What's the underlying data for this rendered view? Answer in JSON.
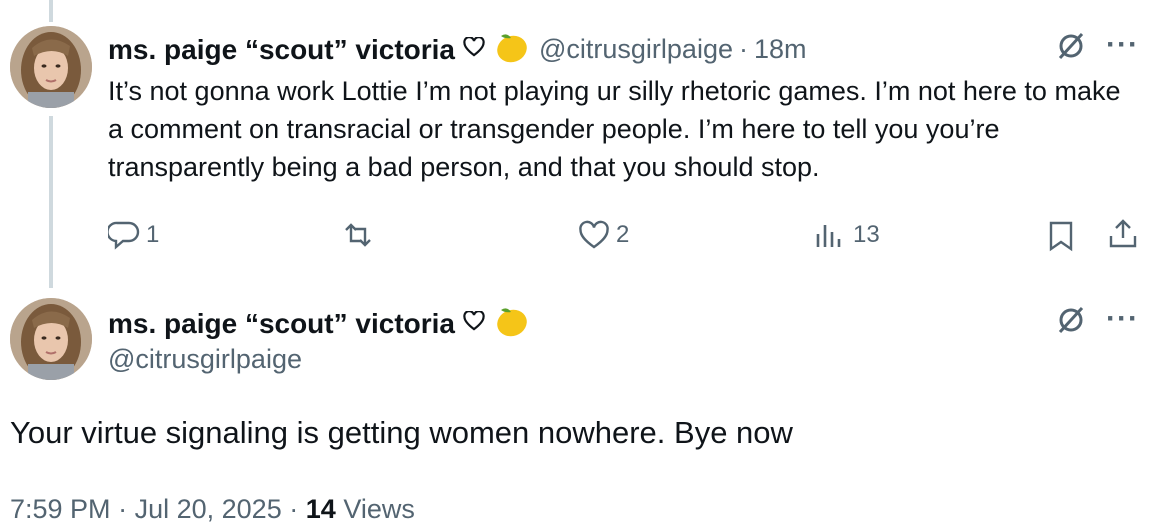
{
  "reply_tweet": {
    "author_name": "ms. paige “scout” victoria",
    "handle": "@citrusgirlpaige",
    "separator": "·",
    "time_ago": "18m",
    "text": "It’s not gonna work Lottie I’m not playing ur silly rhetoric games. I’m not here to make a comment on transracial or transgender people. I’m here to tell you you’re transparently being a bad person, and that you should stop.",
    "replies": "1",
    "likes": "2",
    "views": "13"
  },
  "main_tweet": {
    "author_name": "ms. paige “scout” victoria",
    "handle": "@citrusgirlpaige",
    "text": "Your virtue signaling is getting women nowhere. Bye now",
    "time": "7:59 PM",
    "date": "Jul 20, 2025",
    "separator": "·",
    "views_count": "14",
    "views_label": "Views"
  },
  "more_label": "···",
  "icons": [
    "heart-outline-icon",
    "lemon-emoji-icon",
    "grok-icon",
    "more-icon",
    "reply-icon",
    "retweet-icon",
    "like-icon",
    "views-icon",
    "bookmark-icon",
    "share-icon"
  ],
  "colors": {
    "text": "#0f1419",
    "secondary": "#536471",
    "thread_line": "#cfd9de",
    "lemon": "#f5c518"
  }
}
